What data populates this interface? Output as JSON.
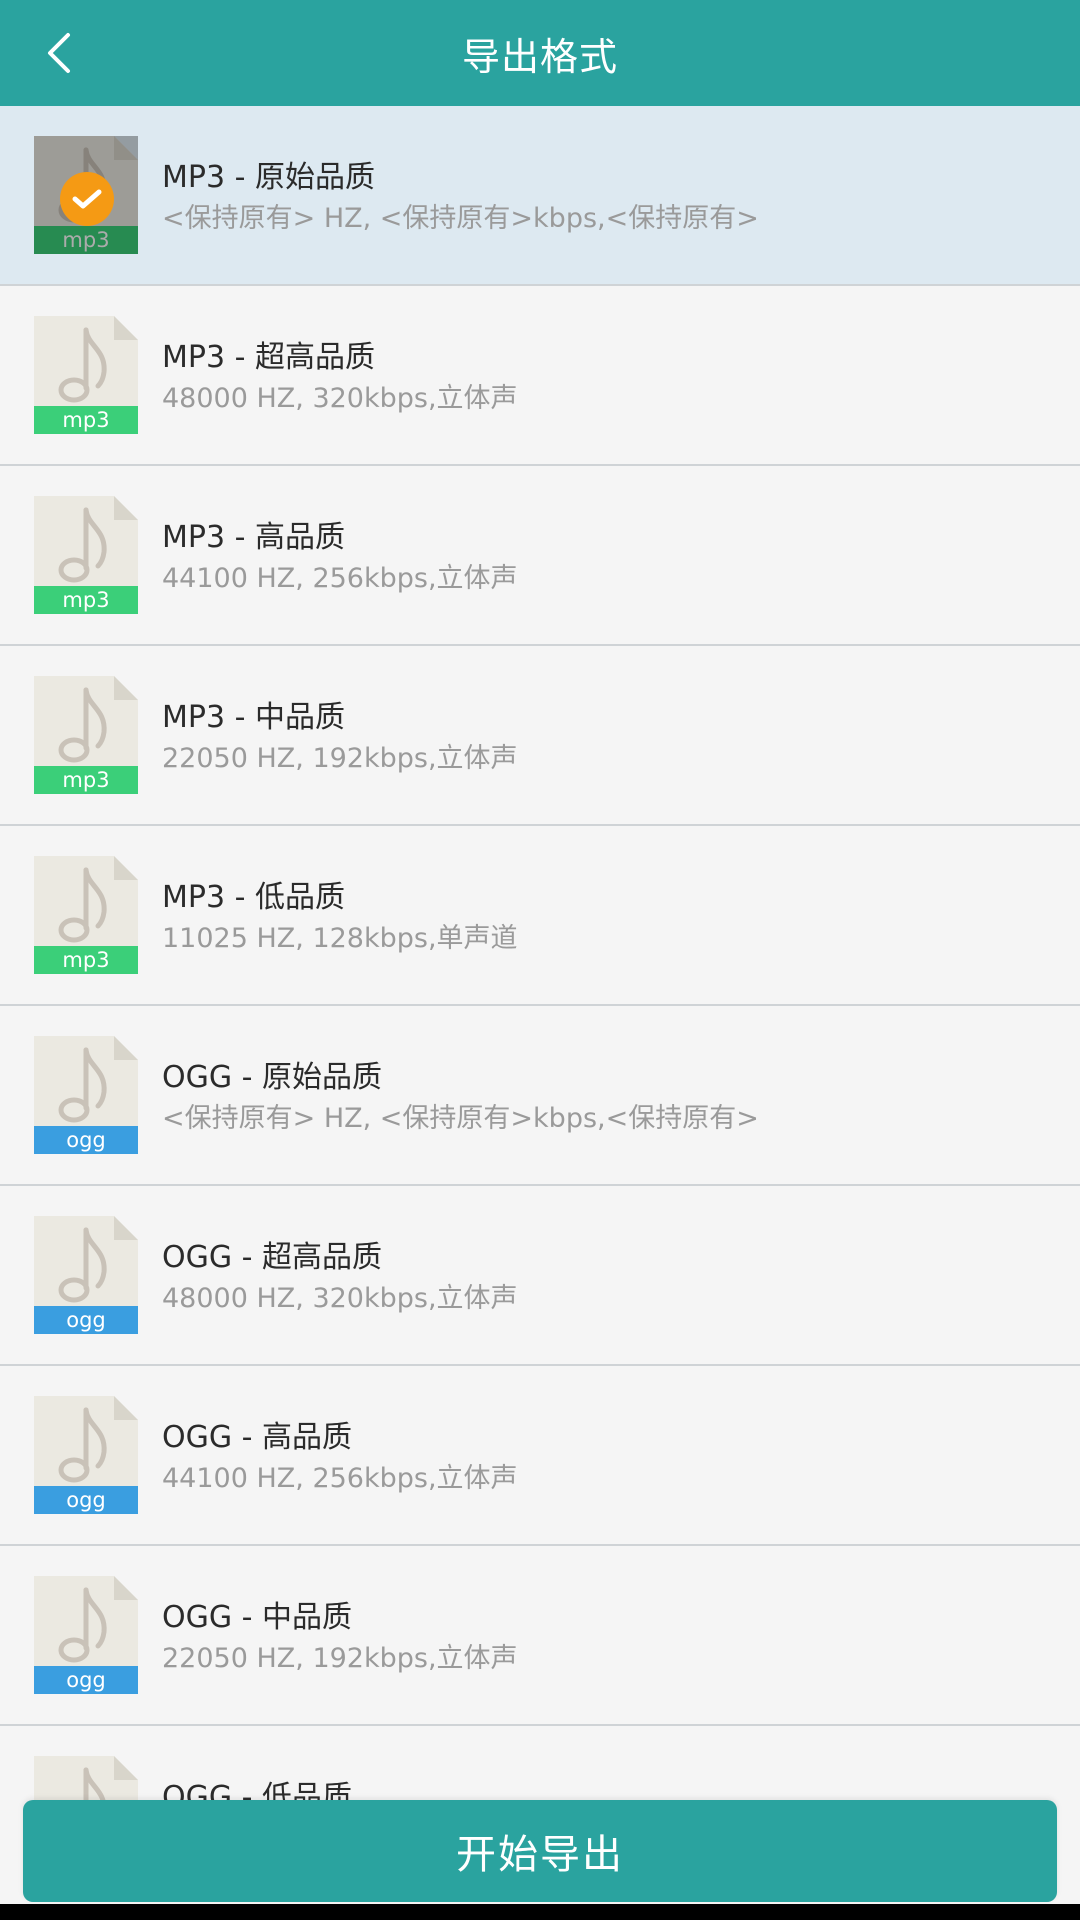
{
  "header": {
    "title": "导出格式",
    "back_icon": "chevron-left-icon"
  },
  "colors": {
    "primary": "#2aa39f",
    "mp3_badge": "#3bcf79",
    "ogg_badge": "#3a9ee0",
    "check": "#f59a14",
    "selected_bg": "#dde9f1"
  },
  "items": [
    {
      "title": "MP3 - 原始品质",
      "sub": "<保持原有> HZ, <保持原有>kbps,<保持原有>",
      "format": "mp3",
      "selected": true
    },
    {
      "title": "MP3 - 超高品质",
      "sub": "48000 HZ, 320kbps,立体声",
      "format": "mp3",
      "selected": false
    },
    {
      "title": "MP3 - 高品质",
      "sub": "44100 HZ, 256kbps,立体声",
      "format": "mp3",
      "selected": false
    },
    {
      "title": "MP3 - 中品质",
      "sub": "22050 HZ, 192kbps,立体声",
      "format": "mp3",
      "selected": false
    },
    {
      "title": "MP3 - 低品质",
      "sub": "11025 HZ, 128kbps,单声道",
      "format": "mp3",
      "selected": false
    },
    {
      "title": "OGG - 原始品质",
      "sub": "<保持原有> HZ, <保持原有>kbps,<保持原有>",
      "format": "ogg",
      "selected": false
    },
    {
      "title": "OGG - 超高品质",
      "sub": "48000 HZ, 320kbps,立体声",
      "format": "ogg",
      "selected": false
    },
    {
      "title": "OGG - 高品质",
      "sub": "44100 HZ, 256kbps,立体声",
      "format": "ogg",
      "selected": false
    },
    {
      "title": "OGG - 中品质",
      "sub": "22050 HZ, 192kbps,立体声",
      "format": "ogg",
      "selected": false
    },
    {
      "title": "OGG - 低品质",
      "sub": "",
      "format": "ogg",
      "selected": false
    }
  ],
  "footer": {
    "export_label": "开始导出"
  }
}
